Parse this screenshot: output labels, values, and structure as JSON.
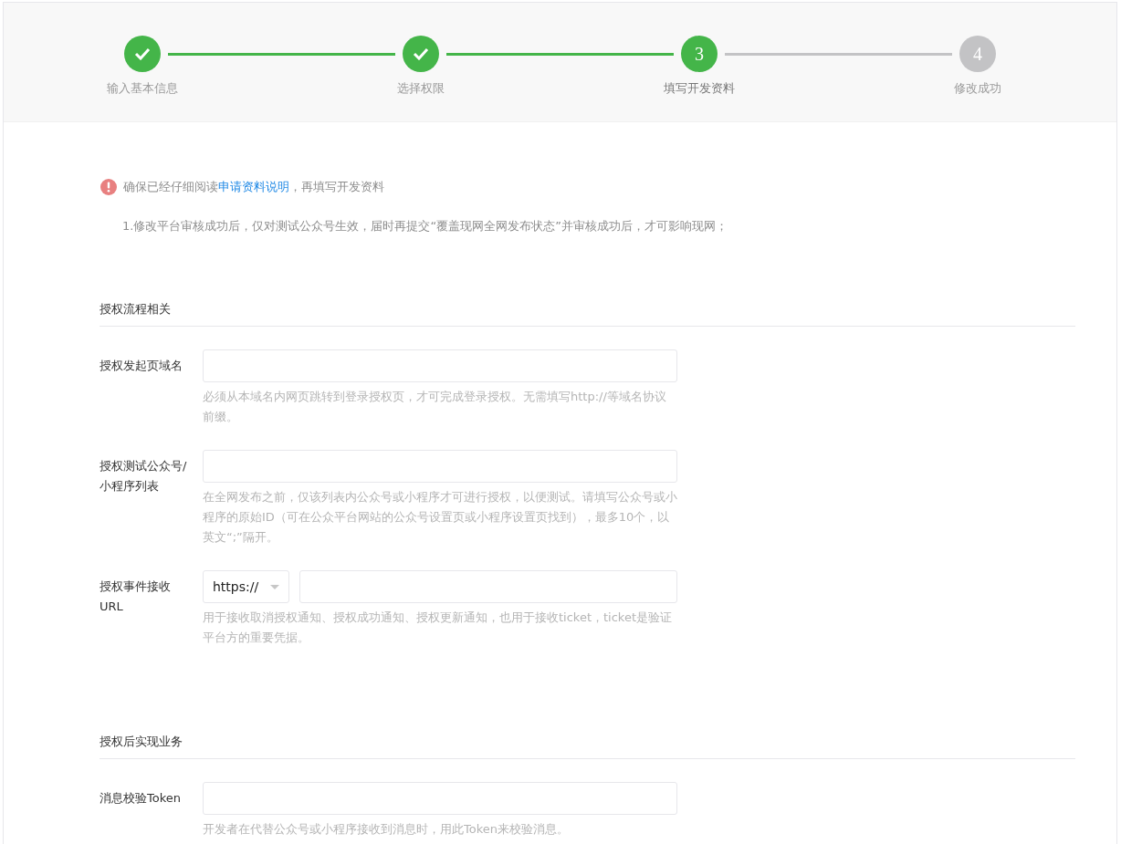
{
  "steps": [
    {
      "label": "输入基本信息",
      "done": true,
      "selected": false
    },
    {
      "label": "选择权限",
      "done": true,
      "selected": false
    },
    {
      "number": "3",
      "label": "填写开发资料",
      "done": false,
      "selected": true
    },
    {
      "number": "4",
      "label": "修改成功",
      "done": false,
      "selected": false
    }
  ],
  "notice": {
    "before": "确保已经仔细阅读",
    "link": "申请资料说明",
    "after": "，再填写开发资料"
  },
  "notes": [
    "1.修改平台审核成功后，仅对测试公众号生效，届时再提交“覆盖现网全网发布状态”并审核成功后，才可影响现网；"
  ],
  "sections": [
    {
      "title": "授权流程相关",
      "fields": [
        {
          "kind": "text",
          "label": "授权发起页域名",
          "hint": "必须从本域名内网页跳转到登录授权页，才可完成登录授权。无需填写http://等域名协议前缀。"
        },
        {
          "kind": "text",
          "label": "授权测试公众号/小程序列表",
          "hint": "在全网发布之前，仅该列表内公众号或小程序才可进行授权，以便测试。请填写公众号或小程序的原始ID（可在公众平台网站的公众号设置页或小程序设置页找到），最多10个，以英文“;”隔开。"
        },
        {
          "kind": "url",
          "label": "授权事件接收URL",
          "protocol": "https://",
          "hint": "用于接收取消授权通知、授权成功通知、授权更新通知，也用于接收ticket，ticket是验证平台方的重要凭据。"
        }
      ]
    },
    {
      "title": "授权后实现业务",
      "fields": [
        {
          "kind": "text",
          "label": "消息校验Token",
          "hint": "开发者在代替公众号或小程序接收到消息时，用此Token来校验消息。"
        }
      ]
    }
  ]
}
